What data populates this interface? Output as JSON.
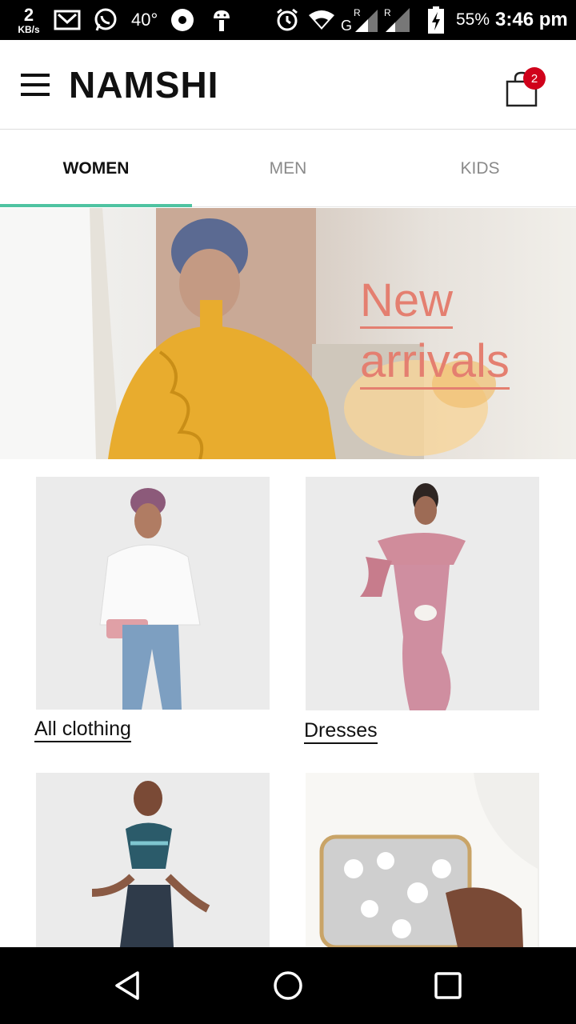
{
  "status_bar": {
    "net_speed_value": "2",
    "net_speed_unit": "KB/s",
    "temperature": "40°",
    "battery": "55%",
    "time": "3:46 pm",
    "icons": [
      "gmail-icon",
      "whatsapp-icon",
      "media-icon",
      "android-icon",
      "alarm-icon",
      "wifi-icon",
      "signal-icon",
      "battery-icon"
    ]
  },
  "header": {
    "brand": "NAMSHI",
    "cart_count": "2"
  },
  "tabs": [
    {
      "label": "WOMEN",
      "active": true
    },
    {
      "label": "MEN",
      "active": false
    },
    {
      "label": "KIDS",
      "active": false
    }
  ],
  "hero": {
    "line1": "New",
    "line2": "arrivals"
  },
  "categories": [
    {
      "label": "All clothing"
    },
    {
      "label": "Dresses"
    },
    {
      "label": ""
    },
    {
      "label": ""
    }
  ],
  "colors": {
    "accent": "#4fc3a1",
    "badge": "#d0021b",
    "hero_text": "#e47f70"
  }
}
